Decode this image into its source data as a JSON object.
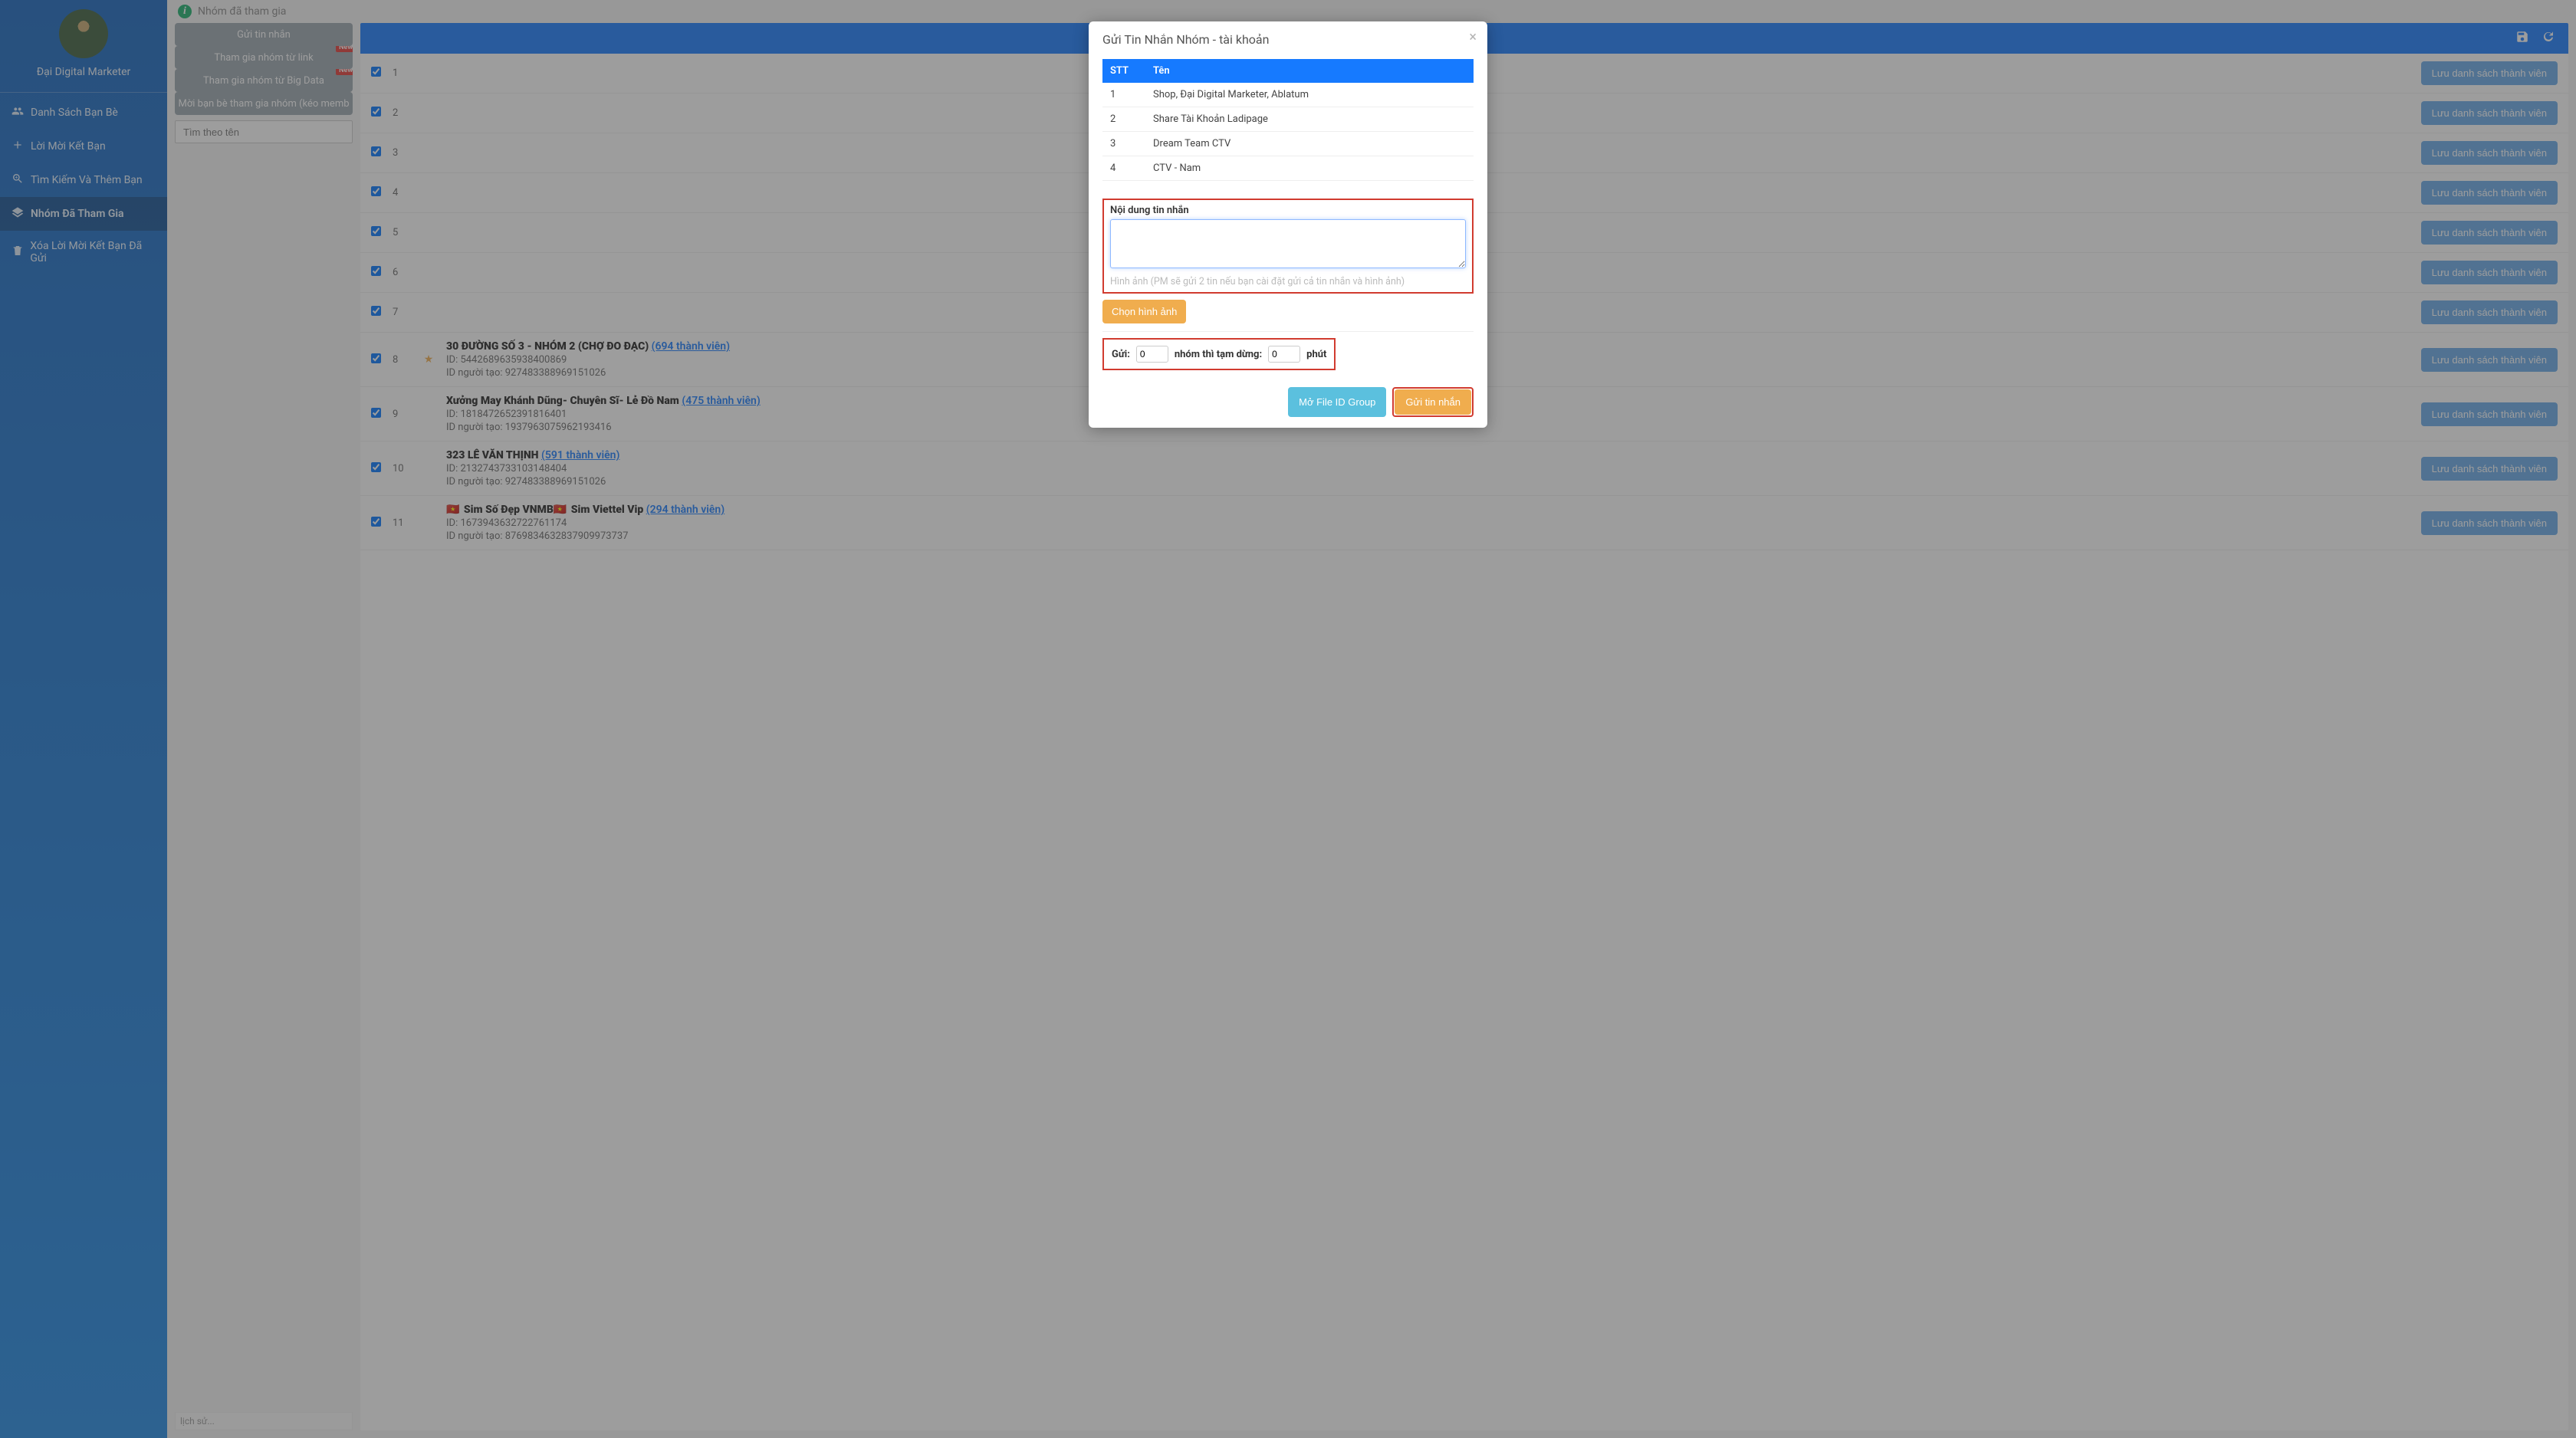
{
  "sidebar": {
    "profile_name": "Đại Digital Marketer",
    "items": [
      {
        "icon": "users-icon",
        "label": "Danh Sách Bạn Bè"
      },
      {
        "icon": "plus-icon",
        "label": "Lời Mời Kết Bạn"
      },
      {
        "icon": "search-plus-icon",
        "label": "Tìm Kiếm Và Thêm Bạn"
      },
      {
        "icon": "layers-icon",
        "label": "Nhóm Đã Tham Gia"
      },
      {
        "icon": "trash-icon",
        "label": "Xóa Lời Mời Kết Bạn Đã Gửi"
      }
    ],
    "active_index": 3
  },
  "page_title": "Nhóm đã tham gia",
  "left_actions": [
    {
      "label": "Gửi tin nhắn",
      "new": false
    },
    {
      "label": "Tham gia nhóm từ link",
      "new": true
    },
    {
      "label": "Tham gia nhóm từ Big Data",
      "new": true
    },
    {
      "label": "Mời bạn bè tham gia nhóm (kéo memb",
      "new": false
    }
  ],
  "search_placeholder": "Tìm theo tên",
  "history_label": "lịch sử...",
  "header_icons": {
    "save": "save-icon",
    "refresh": "refresh-icon"
  },
  "group_row_button": "Lưu danh sách thành viên",
  "groups": [
    {
      "num": 1,
      "checked": true,
      "title_hidden": true
    },
    {
      "num": 2,
      "checked": true,
      "title_hidden": true
    },
    {
      "num": 3,
      "checked": true,
      "title_hidden": true
    },
    {
      "num": 4,
      "checked": true,
      "title_hidden": true
    },
    {
      "num": 5,
      "checked": true,
      "title_hidden": true
    },
    {
      "num": 6,
      "checked": true,
      "title_hidden": true
    },
    {
      "num": 7,
      "checked": true,
      "title_hidden": true
    },
    {
      "num": 8,
      "checked": true,
      "star": true,
      "title": "30 ĐƯỜNG SỐ 3 - NHÓM 2 (CHỢ ĐO ĐẠC)",
      "members": "(694 thành viên)",
      "id": "5442689635938400869",
      "creator": "927483388969151026"
    },
    {
      "num": 9,
      "checked": true,
      "title": "Xưởng May Khánh Dũng- Chuyên Sĩ- Lẻ Đồ Nam",
      "members": "(475 thành viên)",
      "id": "1818472652391816401",
      "creator": "1937963075962193416"
    },
    {
      "num": 10,
      "checked": true,
      "title": "323 LÊ VĂN THỊNH",
      "members": "(591 thành viên)",
      "id": "2132743733103148404",
      "creator": "927483388969151026"
    },
    {
      "num": 11,
      "checked": true,
      "flags": true,
      "title_parts": [
        "Sim Số Đẹp VNMB",
        "Sim Viettel Vip"
      ],
      "members": "(294 thành viên)",
      "id": "1673943632722761174",
      "creator": "8769834632837909973737"
    }
  ],
  "id_label_prefix": "ID: ",
  "creator_label_prefix": "ID người tạo: ",
  "modal": {
    "title": "Gửi Tin Nhắn Nhóm - tài khoản",
    "columns": {
      "stt": "STT",
      "name": "Tên"
    },
    "rows": [
      {
        "stt": 1,
        "name": "Shop, Đại Digital Marketer, Ablatum"
      },
      {
        "stt": 2,
        "name": "Share Tài Khoản Ladipage"
      },
      {
        "stt": 3,
        "name": "Dream Team CTV"
      },
      {
        "stt": 4,
        "name": "CTV - Nam"
      }
    ],
    "msg_label": "Nội dung tin nhắn",
    "msg_hint": "Hình ảnh (PM sẽ gửi 2 tin nếu bạn cài đặt gửi cả tin nhắn và hình ảnh)",
    "choose_image": "Chọn hình ảnh",
    "timing": {
      "send_label": "Gửi:",
      "groups_value": "0",
      "pause_label": "nhóm thì tạm dừng:",
      "minutes_value": "0",
      "minutes_label": "phút"
    },
    "footer": {
      "open_file": "Mở File ID Group",
      "send": "Gửi tin nhắn"
    }
  }
}
